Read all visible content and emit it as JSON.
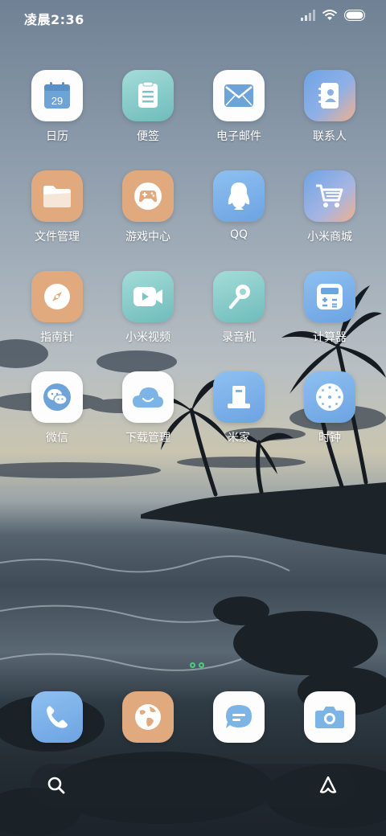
{
  "status_bar": {
    "time": "凌晨2:36",
    "icons": [
      "signal-icon",
      "wifi-icon",
      "battery-icon"
    ]
  },
  "apps": [
    {
      "label": "日历",
      "icon": "calendar-icon",
      "calendar_day": "29"
    },
    {
      "label": "便签",
      "icon": "notes-icon"
    },
    {
      "label": "电子邮件",
      "icon": "mail-icon"
    },
    {
      "label": "联系人",
      "icon": "contacts-icon"
    },
    {
      "label": "文件管理",
      "icon": "folder-icon"
    },
    {
      "label": "游戏中心",
      "icon": "gamepad-icon"
    },
    {
      "label": "QQ",
      "icon": "penguin-icon"
    },
    {
      "label": "小米商城",
      "icon": "shopping-cart-icon"
    },
    {
      "label": "指南针",
      "icon": "compass-icon"
    },
    {
      "label": "小米视频",
      "icon": "video-icon"
    },
    {
      "label": "录音机",
      "icon": "microphone-icon"
    },
    {
      "label": "计算器",
      "icon": "calculator-icon"
    },
    {
      "label": "微信",
      "icon": "wechat-icon"
    },
    {
      "label": "下载管理",
      "icon": "cloud-download-icon"
    },
    {
      "label": "米家",
      "icon": "smart-home-icon"
    },
    {
      "label": "时钟",
      "icon": "clock-icon"
    }
  ],
  "dock": [
    {
      "icon": "phone-icon"
    },
    {
      "icon": "browser-globe-icon"
    },
    {
      "icon": "messages-icon"
    },
    {
      "icon": "camera-icon"
    }
  ],
  "page_indicator": {
    "pages": 2
  },
  "search_bar": {
    "left_icon": "search-icon",
    "right_icon": "assistant-icon"
  }
}
